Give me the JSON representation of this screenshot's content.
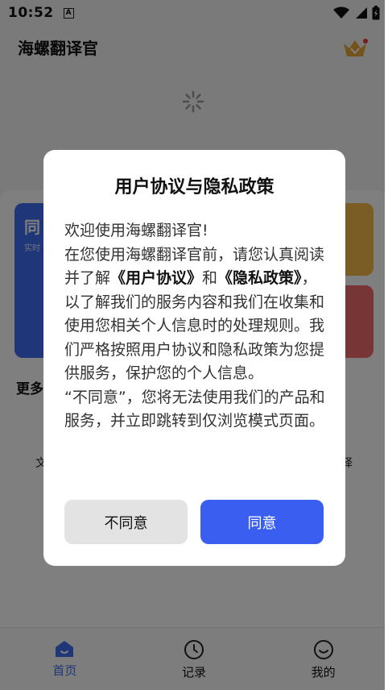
{
  "status_bar": {
    "time": "10:52",
    "notification_badge": "A"
  },
  "app": {
    "title": "海螺翻译官",
    "feature_card_title": "同",
    "feature_card_subtitle": "实时",
    "more_label": "更多",
    "side_text_left": "文",
    "side_text_right": "译"
  },
  "bottom_nav": {
    "items": [
      {
        "label": "首页",
        "icon": "home-icon",
        "active": true
      },
      {
        "label": "记录",
        "icon": "clock-icon",
        "active": false
      },
      {
        "label": "我的",
        "icon": "smile-icon",
        "active": false
      }
    ]
  },
  "dialog": {
    "title": "用户协议与隐私政策",
    "welcome": "欢迎使用海螺翻译官!",
    "para1_a": "在您使用海螺翻译官前，请您认真阅读并了解",
    "user_agreement_link": "《用户协议》",
    "para1_and": "和",
    "privacy_link": "《隐私政策》",
    "para1_b": "，以了解我们的服务内容和我们在收集和使用您相关个人信息时的处理规则。我们严格按照用户协议和隐私政策为您提供服务，保护您的个人信息。",
    "para2": "“不同意”，您将无法使用我们的产品和服务，并立即跳转到仅浏览模式页面。",
    "disagree_label": "不同意",
    "agree_label": "同意"
  },
  "colors": {
    "accent": "#3a5ef0",
    "overlay": "rgba(0,0,0,0.5)",
    "disagree_bg": "#e3e3e3",
    "feature_orange": "#f5b84a",
    "feature_red": "#ee6b6b"
  }
}
